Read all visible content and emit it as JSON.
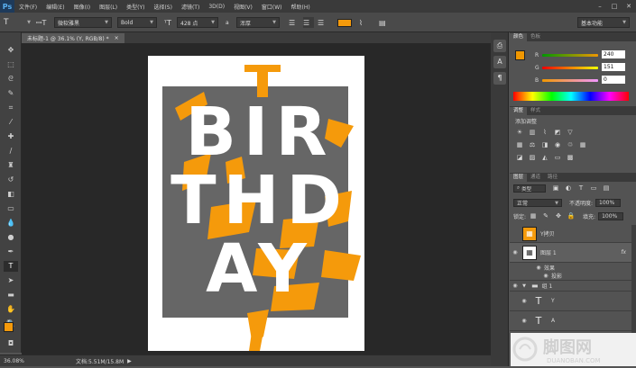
{
  "app": {
    "logo": "Ps",
    "menus": [
      "文件(F)",
      "编辑(E)",
      "图像(I)",
      "图层(L)",
      "类型(Y)",
      "选择(S)",
      "滤镜(T)",
      "3D(D)",
      "视图(V)",
      "窗口(W)",
      "帮助(H)"
    ]
  },
  "options": {
    "font_family": "微软雅黑",
    "font_style": "Bold",
    "font_size": "428 点",
    "aa_label": "a",
    "aa_mode": "浑厚",
    "workspace": "基本功能",
    "accent_color": "#f59a0b"
  },
  "document": {
    "tab_title": "未标题-1 @ 36.1% (Y, RGB/8) *",
    "zoom": "36.08%",
    "doc_info": "文档:5.51M/15.8M",
    "text_lines": [
      "BIR",
      "THD",
      "AY"
    ],
    "backdrop_color": "#666666",
    "letter_color": "#ffffff",
    "accent_shapes_color": "#f59a0b"
  },
  "color_panel": {
    "tabs": [
      "颜色",
      "色板"
    ],
    "channels": [
      {
        "label": "R",
        "value": "240"
      },
      {
        "label": "G",
        "value": "151"
      },
      {
        "label": "B",
        "value": "0"
      }
    ],
    "foreground": "#f09700"
  },
  "adjustments_panel": {
    "tabs": [
      "调整",
      "样式"
    ],
    "title": "添加调整"
  },
  "layers_panel": {
    "tabs": [
      "图层",
      "通道",
      "路径"
    ],
    "filter_kind": "类型",
    "blend_mode": "正常",
    "opacity_label": "不透明度:",
    "opacity_value": "100%",
    "lock_label": "锁定:",
    "fill_label": "填充:",
    "fill_value": "100%",
    "layers": [
      {
        "name": "Y拷贝",
        "kind": "image"
      },
      {
        "name": "图层 1",
        "kind": "image",
        "fx": "fx"
      },
      {
        "name": "效果",
        "kind": "effect"
      },
      {
        "name": "投影",
        "kind": "effect"
      },
      {
        "name": "组 1",
        "kind": "group"
      },
      {
        "name": "Y",
        "kind": "text"
      },
      {
        "name": "A",
        "kind": "text"
      }
    ]
  },
  "watermark": {
    "brand": "脚图网",
    "url": "DUANOBAN.COM"
  }
}
